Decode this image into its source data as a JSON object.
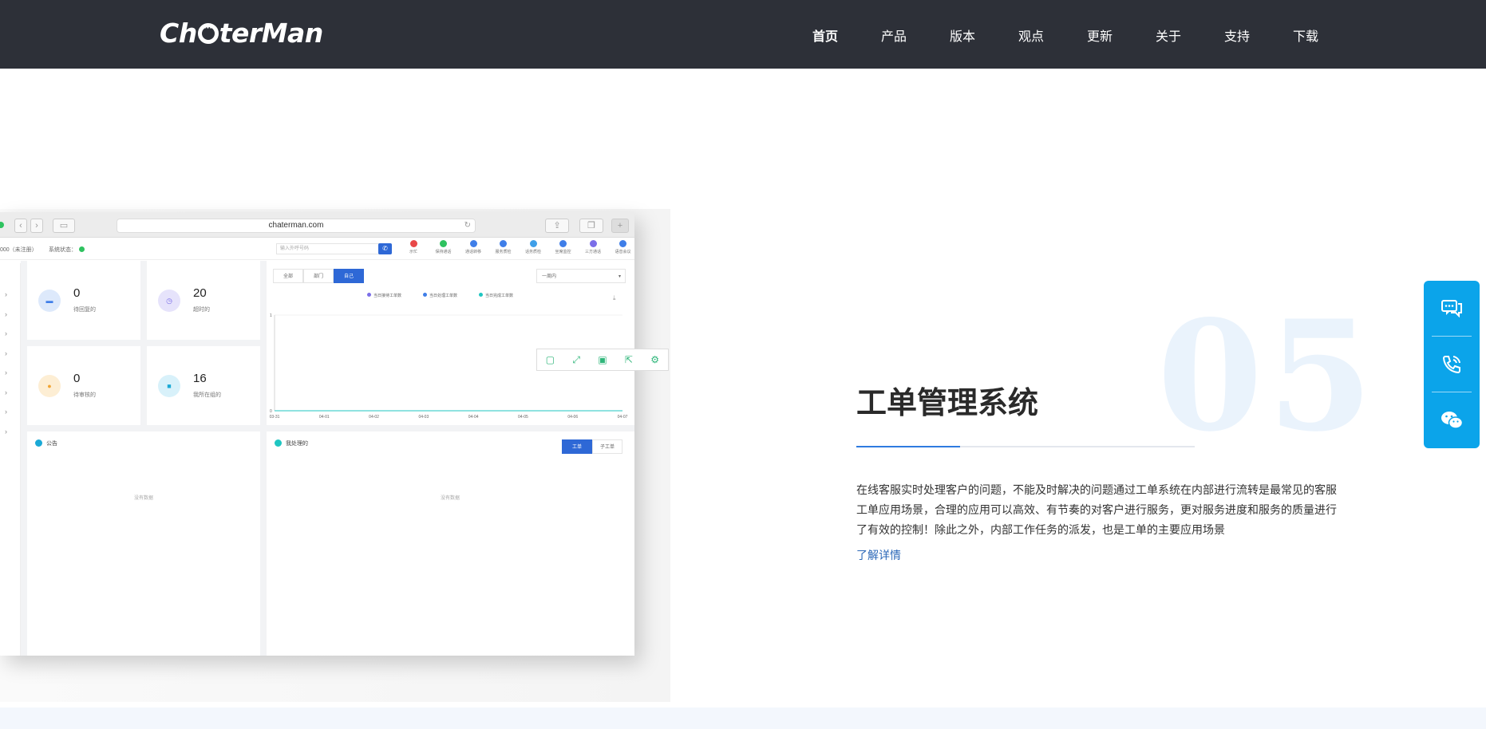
{
  "header": {
    "logo_pre": "Ch",
    "logo_post": "terMan",
    "logo_alt": "ChaterMan",
    "nav": [
      "首页",
      "产品",
      "版本",
      "观点",
      "更新",
      "关于",
      "支持",
      "下载"
    ],
    "active_index": 0
  },
  "mock_browser": {
    "url": "chaterman.com",
    "account_text": "000（未注册）",
    "system_status": "系统状态：",
    "search_placeholder": "输入外呼号码",
    "tools": [
      {
        "label": "示忙",
        "color": "#e84848"
      },
      {
        "label": "保持通话",
        "color": "#2ec25f"
      },
      {
        "label": "通话转移",
        "color": "#3f7ee8"
      },
      {
        "label": "服务质检",
        "color": "#3f7ee8"
      },
      {
        "label": "话务质检",
        "color": "#3f9fe8"
      },
      {
        "label": "坐席监控",
        "color": "#3f7ee8"
      },
      {
        "label": "三方通话",
        "color": "#7b6ee8"
      },
      {
        "label": "语音会议",
        "color": "#3f7ee8"
      }
    ],
    "stats": [
      {
        "value": "0",
        "label": "待回复的",
        "icon": "chat-icon",
        "color": "#dde9fb",
        "fg": "#3f7ee8"
      },
      {
        "value": "20",
        "label": "超时的",
        "icon": "clock-icon",
        "color": "#e6e3fb",
        "fg": "#7b6ee8"
      },
      {
        "value": "0",
        "label": "待审核的",
        "icon": "user-icon",
        "color": "#fdeed4",
        "fg": "#f2a533"
      },
      {
        "value": "16",
        "label": "我所在组的",
        "icon": "briefcase-icon",
        "color": "#d8f1fa",
        "fg": "#1aa9d6"
      }
    ],
    "tabs": [
      "全部",
      "部门",
      "自己"
    ],
    "active_tab": 2,
    "range_select": "一周内",
    "legend": [
      {
        "label": "当日接待工单数",
        "color": "#7b6ee8"
      },
      {
        "label": "当日处理工单数",
        "color": "#3f7ee8"
      },
      {
        "label": "当日完成工单数",
        "color": "#1fc6c2"
      }
    ],
    "panel_notice": "公告",
    "panel_handled": "我处理的",
    "handled_tabs": [
      "工单",
      "子工单"
    ],
    "empty_text": "没有数据"
  },
  "chart_data": {
    "type": "line",
    "x": [
      "03-31",
      "04-01",
      "04-02",
      "04-03",
      "04-04",
      "04-05",
      "04-06",
      "04-07"
    ],
    "ylim": [
      0,
      1
    ],
    "yticks": [
      "0",
      "1"
    ],
    "series": [
      {
        "name": "当日接待工单数",
        "values": [
          0,
          0,
          0,
          0,
          0,
          0,
          0,
          0
        ]
      },
      {
        "name": "当日处理工单数",
        "values": [
          0,
          0,
          0,
          0,
          0,
          0,
          0,
          0
        ]
      },
      {
        "name": "当日完成工单数",
        "values": [
          0,
          0,
          0,
          0,
          0,
          0,
          0,
          0
        ]
      }
    ]
  },
  "section": {
    "number": "05",
    "title": "工单管理系统",
    "description_lines": [
      "在线客服实时处理客户的问题，不能及时解决的问题通过工单系统在内部进行流转是最常见的客服",
      "工单应用场景，合理的应用可以高效、有节奏的对客户进行服务，更对服务进度和服务的质量进行",
      "了有效的控制！除此之外，内部工作任务的派发，也是工单的主要应用场景"
    ],
    "link": "了解详情"
  },
  "colors": {
    "topbar": "#2d3038",
    "accent": "#2e68d6",
    "side_float": "#0ba4ea"
  }
}
